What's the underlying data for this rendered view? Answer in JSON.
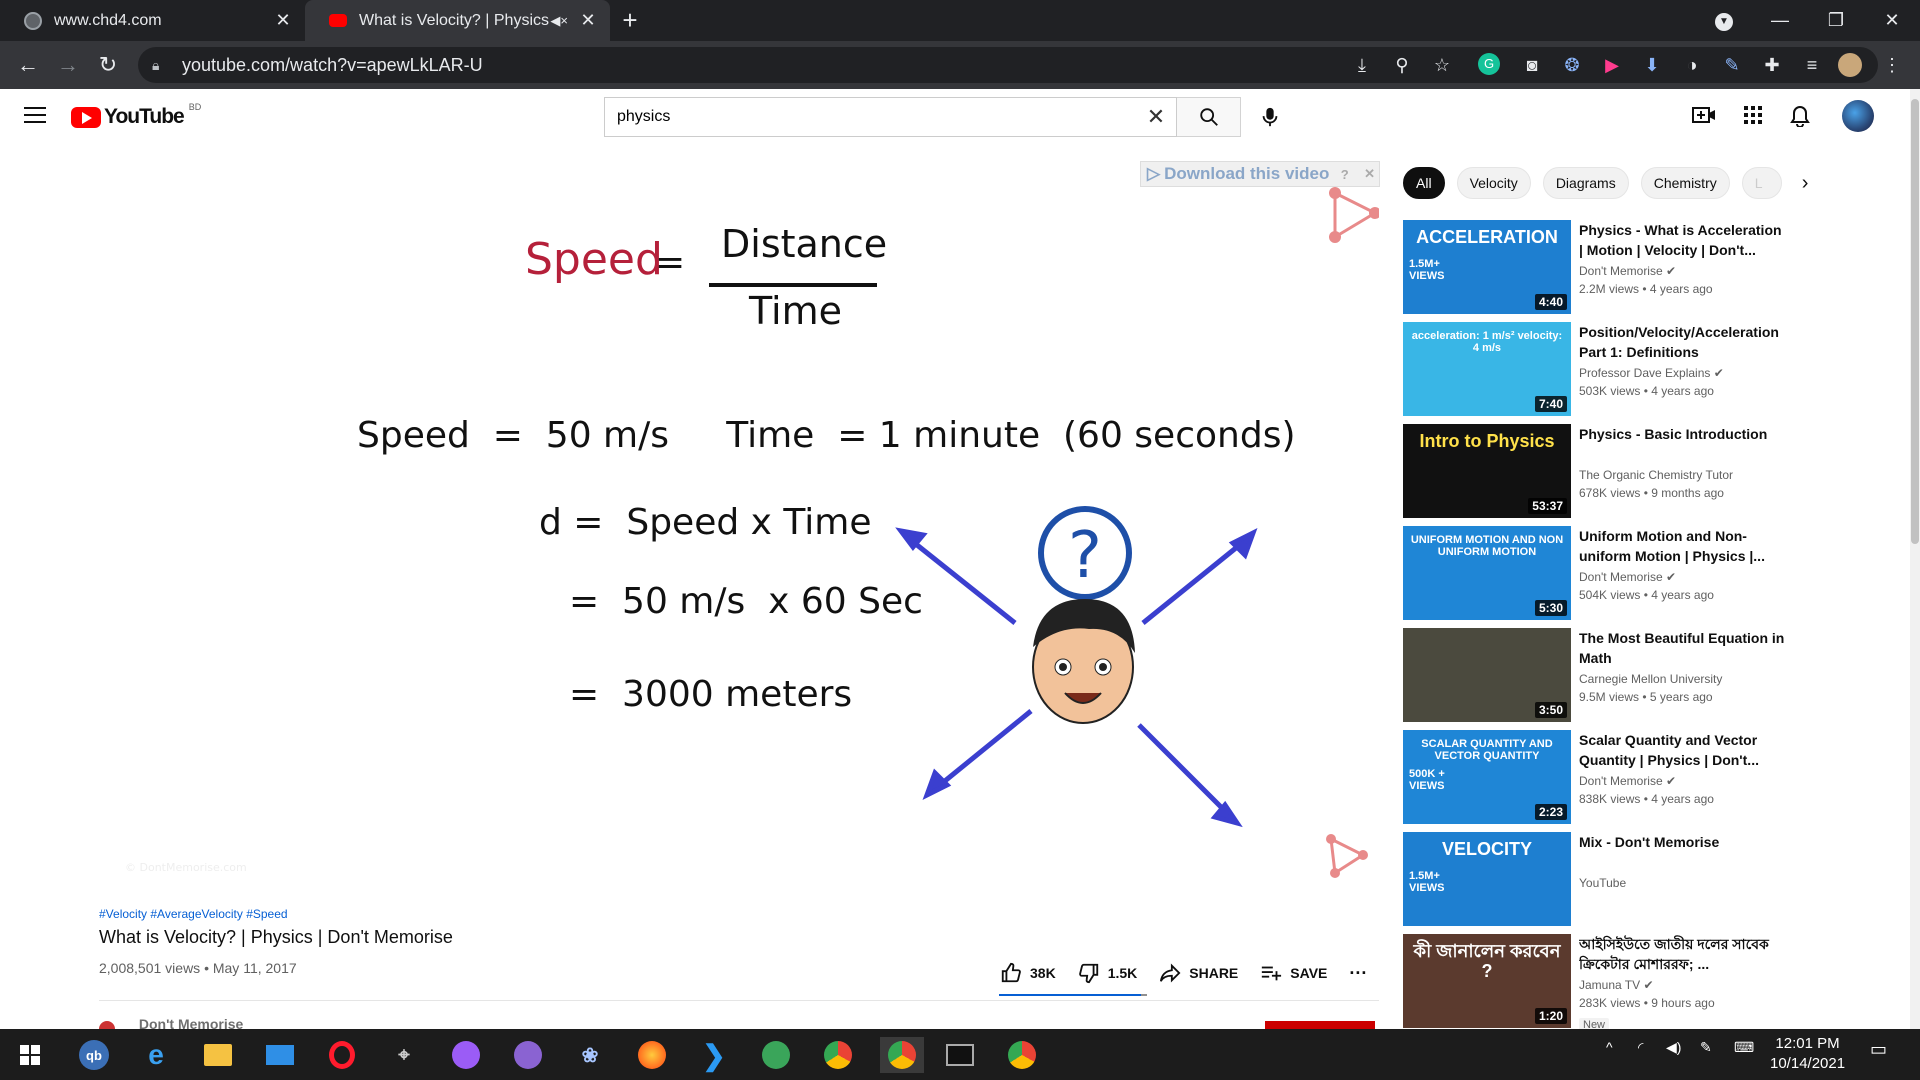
{
  "browser": {
    "tabs": [
      {
        "title": "www.chd4.com",
        "favicon_color": "#5f6368",
        "close": "✕"
      },
      {
        "title": "What is Velocity? | Physics | D",
        "favicon_color": "#ff0000",
        "close": "✕"
      }
    ],
    "new_tab": "+",
    "address": "youtube.com/watch?v=apewLkLAR-U"
  },
  "youtube": {
    "logo_text": "YouTube",
    "region": "BD",
    "search_value": "physics",
    "clear_symbol": "✕"
  },
  "player": {
    "download_banner": "Download this video",
    "watermark": "© DontMemorise.com",
    "slide": {
      "speed_word": "Speed",
      "eq": "=",
      "numerator": "Distance",
      "denominator": "Time",
      "line1": "Speed  =  50 m/s     Time  = 1 minute  (60 seconds)",
      "line2": "d =  Speed x Time",
      "line3": "=  50 m/s  x 60 Sec",
      "line4": "=  3000 meters",
      "question": "?"
    }
  },
  "video": {
    "hashtags": "#Velocity #AverageVelocity #Speed",
    "title": "What is Velocity? | Physics | Don't Memorise",
    "meta": "2,008,501 views • May 11, 2017",
    "likes": "38K",
    "dislikes": "1.5K",
    "share": "SHARE",
    "save": "SAVE",
    "more": "···",
    "channel": "Don't Memorise"
  },
  "chips": [
    "All",
    "Velocity",
    "Diagrams",
    "Chemistry",
    "L"
  ],
  "recommendations": [
    {
      "title": "Physics - What is Acceleration | Motion | Velocity | Don't...",
      "channel": "Don't Memorise",
      "verified": true,
      "meta": "2.2M views • 4 years ago",
      "duration": "4:40",
      "thumb_text": "ACCELERATION",
      "thumb_sub": "1.5M+ VIEWS",
      "thumb_bg": "#1e7fd0"
    },
    {
      "title": "Position/Velocity/Acceleration Part 1: Definitions",
      "channel": "Professor Dave Explains",
      "verified": true,
      "meta": "503K views • 4 years ago",
      "duration": "7:40",
      "thumb_text": "acceleration: 1 m/s²   velocity: 4 m/s",
      "thumb_sub": "",
      "thumb_bg": "#39b6e6"
    },
    {
      "title": "Physics - Basic Introduction",
      "channel": "The Organic Chemistry Tutor",
      "verified": false,
      "meta": "678K views • 9 months ago",
      "duration": "53:37",
      "thumb_text": "Intro to Physics",
      "thumb_sub": "",
      "thumb_bg": "#111111"
    },
    {
      "title": "Uniform Motion and Non-uniform Motion | Physics |...",
      "channel": "Don't Memorise",
      "verified": true,
      "meta": "504K views • 4 years ago",
      "duration": "5:30",
      "thumb_text": "UNIFORM MOTION AND NON UNIFORM MOTION",
      "thumb_sub": "",
      "thumb_bg": "#1f86d6"
    },
    {
      "title": "The Most Beautiful Equation in Math",
      "channel": "Carnegie Mellon University",
      "verified": false,
      "meta": "9.5M views • 5 years ago",
      "duration": "3:50",
      "thumb_text": "",
      "thumb_sub": "",
      "thumb_bg": "#4b4a3e"
    },
    {
      "title": "Scalar Quantity and Vector Quantity | Physics | Don't...",
      "channel": "Don't Memorise",
      "verified": true,
      "meta": "838K views • 4 years ago",
      "duration": "2:23",
      "thumb_text": "SCALAR QUANTITY AND VECTOR QUANTITY",
      "thumb_sub": "500K + VIEWS",
      "thumb_bg": "#1f86d6"
    },
    {
      "title": "Mix - Don't Memorise",
      "channel": "YouTube",
      "verified": false,
      "meta": "",
      "duration": "",
      "thumb_text": "VELOCITY",
      "thumb_sub": "1.5M+ VIEWS",
      "thumb_bg": "#1e7fd0"
    },
    {
      "title": "আইসিইউতে জাতীয় দলের সাবেক ক্রিকেটার মোশাররফ; ...",
      "channel": "Jamuna TV",
      "verified": true,
      "meta": "283K views • 9 hours ago",
      "duration": "1:20",
      "thumb_text": "কী জানালেন করবেন ?",
      "thumb_sub": "",
      "thumb_bg": "#5b3a2e",
      "badge": "New"
    }
  ],
  "taskbar": {
    "time": "12:01 PM",
    "date": "10/14/2021"
  }
}
